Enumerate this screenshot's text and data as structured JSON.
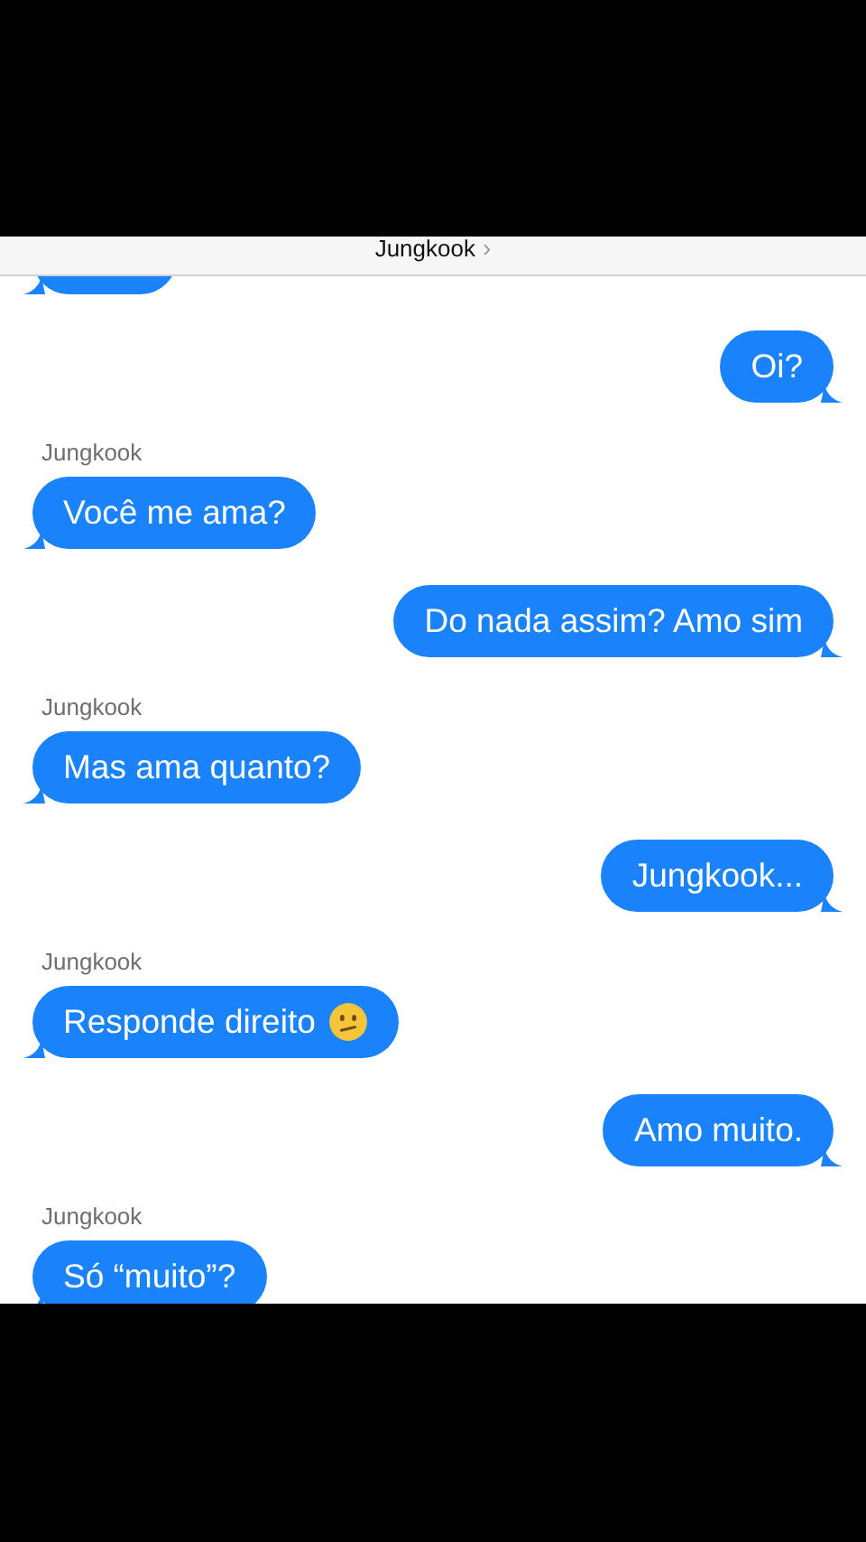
{
  "header": {
    "title": "Jungkook",
    "chevron": "›"
  },
  "messages": [
    {
      "kind": "clipped"
    },
    {
      "kind": "outgoing",
      "text": "Oi?"
    },
    {
      "kind": "incoming",
      "sender": "Jungkook",
      "text": "Você me ama?"
    },
    {
      "kind": "outgoing",
      "text": "Do nada assim? Amo sim"
    },
    {
      "kind": "incoming",
      "sender": "Jungkook",
      "text": "Mas ama quanto?"
    },
    {
      "kind": "outgoing",
      "text": "Jungkook..."
    },
    {
      "kind": "incoming",
      "sender": "Jungkook",
      "text": "Responde direito",
      "confused_emoji": true
    },
    {
      "kind": "outgoing",
      "text": "Amo muito."
    },
    {
      "kind": "incoming",
      "sender": "Jungkook",
      "text": "Só “muito”?"
    }
  ]
}
